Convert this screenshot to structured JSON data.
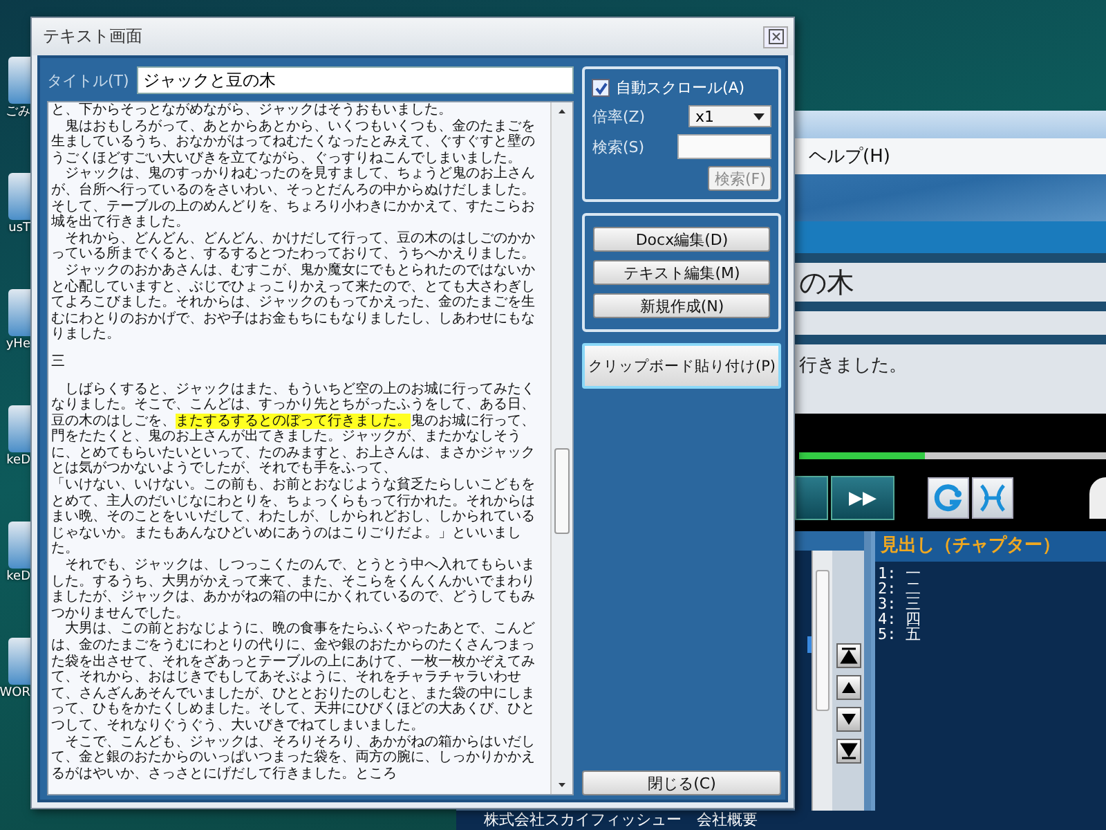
{
  "desktop_icons": [
    {
      "label": "ごみ"
    },
    {
      "label": "usT"
    },
    {
      "label": "yHe"
    },
    {
      "label": "keD"
    },
    {
      "label": "keD"
    },
    {
      "label": "WOR"
    }
  ],
  "background_app": {
    "menu": [
      "ヘルプ(H)"
    ],
    "title_field": "の木",
    "text_line": "行きました。",
    "progress": {
      "level": 0.41
    },
    "player_buttons": [
      {
        "kind": "blank"
      },
      {
        "kind": "text",
        "label": "▶▶"
      }
    ],
    "tool_buttons": [
      {
        "kind": "circular-arrow"
      },
      {
        "kind": "crossed-curves"
      }
    ],
    "nav_buttons": [
      {
        "kind": "top"
      },
      {
        "kind": "up"
      },
      {
        "kind": "down"
      },
      {
        "kind": "bottom"
      }
    ],
    "chapter_panel": {
      "title": "見出し（チャプター）",
      "items": [
        {
          "number": "1:",
          "label": "一"
        },
        {
          "number": "2:",
          "label": "二"
        },
        {
          "number": "3:",
          "label": "三"
        },
        {
          "number": "4:",
          "label": "四"
        },
        {
          "number": "5:",
          "label": "五"
        }
      ]
    },
    "footer": "株式会社スカイフィッシュー　会社概要"
  },
  "dialog": {
    "title": "テキスト画面",
    "title_label": "タイトル(T)",
    "title_value": "ジャックと豆の木",
    "paragraphs": [
      {
        "kind": "text",
        "segments": [
          {
            "text": "と、下からそっとながめながら、ジャックはそうおもいました。",
            "highlighted": false
          }
        ]
      },
      {
        "kind": "text",
        "segments": [
          {
            "text": "　鬼はおもしろがって、あとからあとから、いくつもいくつも、金のたまごを生ましているうち、おなかがはってねむたくなったとみえて、ぐすぐすと壁のうごくほどすごい大いびきを立てながら、ぐっすりねこんでしまいました。",
            "highlighted": false
          }
        ]
      },
      {
        "kind": "text",
        "segments": [
          {
            "text": "　ジャックは、鬼のすっかりねむったのを見すまして、ちょうど鬼のお上さんが、台所へ行っているのをさいわい、そっとだんろの中からぬけだしました。そして、テーブルの上のめんどりを、ちょろり小わきにかかえて、すたこらお城を出て行きました。",
            "highlighted": false
          }
        ]
      },
      {
        "kind": "text",
        "segments": [
          {
            "text": "　それから、どんどん、どんどん、かけだして行って、豆の木のはしごのかかっている所までくると、するするとつたわっておりて、うちへかえりました。",
            "highlighted": false
          }
        ]
      },
      {
        "kind": "text",
        "segments": [
          {
            "text": "　ジャックのおかあさんは、むすこが、鬼か魔女にでもとられたのではないかと心配していますと、ぶじでひょっこりかえって来たので、とても大さわぎしてよろこびました。それからは、ジャックのもってかえった、金のたまごを生むにわとりのおかげで、おや子はお金もちにもなりましたし、しあわせにもなりました。",
            "highlighted": false
          }
        ]
      },
      {
        "kind": "heading",
        "segments": [
          {
            "text": "三",
            "highlighted": false
          }
        ]
      },
      {
        "kind": "text",
        "segments": [
          {
            "text": "　しばらくすると、ジャックはまた、もういちど空の上のお城に行ってみたくなりました。そこで、こんどは、すっかり先とちがったふうをして、ある日、豆の木のはしごを、",
            "highlighted": false
          },
          {
            "text": "またするするとのぼって行きました。",
            "highlighted": true
          },
          {
            "text": "鬼のお城に行って、門をたたくと、鬼のお上さんが出てきました。ジャックが、またかなしそうに、とめてもらいたいといって、たのみますと、お上さんは、まさかジャックとは気がつかないようでしたが、それでも手をふって、",
            "highlighted": false
          }
        ]
      },
      {
        "kind": "text",
        "segments": [
          {
            "text": "「いけない、いけない。この前も、お前とおなじような貧乏たらしいこどもをとめて、主人のだいじなにわとりを、ちょっくらもって行かれた。それからはまい晩、そのことをいいだして、わたしが、しかられどおし、しかられているじゃないか。またもあんなひどいめにあうのはこりごりだよ。」といいました。",
            "highlighted": false
          }
        ]
      },
      {
        "kind": "text",
        "segments": [
          {
            "text": "　それでも、ジャックは、しつっこくたのんで、とうとう中へ入れてもらいました。するうち、大男がかえって来て、また、そこらをくんくんかいでまわりましたが、ジャックは、あかがねの箱の中にかくれているので、どうしてもみつかりませんでした。",
            "highlighted": false
          }
        ]
      },
      {
        "kind": "text",
        "segments": [
          {
            "text": "　大男は、この前とおなじように、晩の食事をたらふくやったあとで、こんどは、金のたまごをうむにわとりの代りに、金や銀のおたからのたくさんつまった袋を出させて、それをざあっとテーブルの上にあけて、一枚一枚かぞえてみて、それから、おはじきでもしてあそぶように、それをチャラチャラいわせて、さんざんあそんでいましたが、ひととおりたのしむと、また袋の中にしまって、ひもをかたくしめました。そして、天井にひびくほどの大あくび、ひとつして、それなりぐうぐう、大いびきでねてしまいました。",
            "highlighted": false
          }
        ]
      },
      {
        "kind": "text",
        "segments": [
          {
            "text": "　そこで、こんども、ジャックは、そろりそろり、あかがねの箱からはいだして、金と銀のおたからのいっぱいつまった袋を、両方の腕に、しっかりかかえるがはやいか、さっさとにげだして行きました。ところ",
            "highlighted": false
          }
        ]
      }
    ],
    "auto_scroll": {
      "label": "自動スクロール(A)",
      "checked": true
    },
    "zoom": {
      "label": "倍率(Z)",
      "value": "x1"
    },
    "search": {
      "label": "検索(S)",
      "button": "検索(F)",
      "disabled": true
    },
    "edit_buttons": [
      "Docx編集(D)",
      "テキスト編集(M)",
      "新規作成(N)"
    ],
    "paste_button": {
      "label": "クリップボード貼り付け(P)",
      "focused": true
    },
    "close_button": "閉じる(C)"
  }
}
